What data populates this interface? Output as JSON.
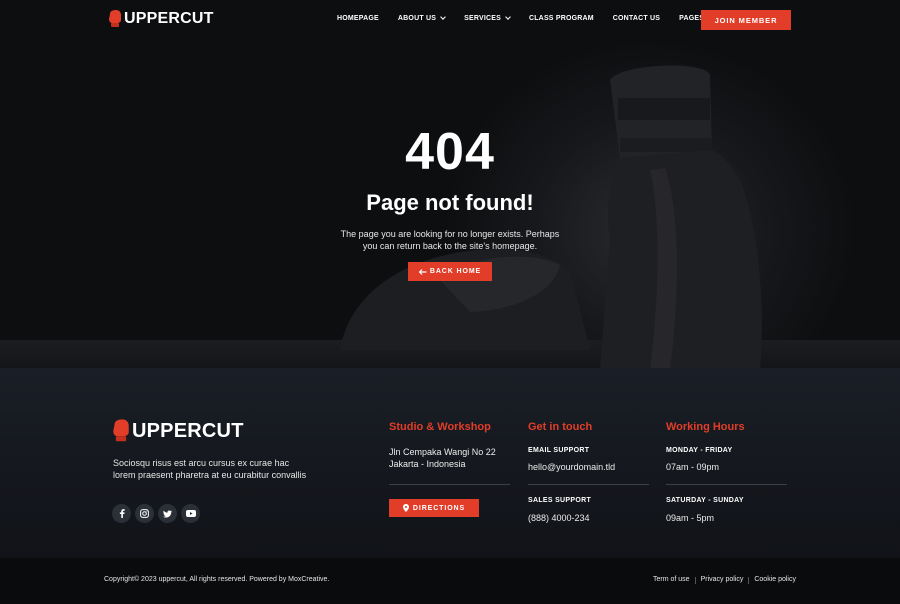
{
  "brand": {
    "name": "UPPERCUT",
    "accent": "#e23d28",
    "logo_icon": "boxing-glove-icon"
  },
  "nav": {
    "items": [
      {
        "label": "HOMEPAGE",
        "has_dropdown": false
      },
      {
        "label": "ABOUT US",
        "has_dropdown": true
      },
      {
        "label": "SERVICES",
        "has_dropdown": true
      },
      {
        "label": "CLASS PROGRAM",
        "has_dropdown": false
      },
      {
        "label": "CONTACT US",
        "has_dropdown": false
      },
      {
        "label": "PAGES",
        "has_dropdown": true
      }
    ],
    "cta": "JOIN MEMBER"
  },
  "error": {
    "code": "404",
    "title": "Page not found!",
    "message_line1": "The page you are looking for no longer exists. Perhaps",
    "message_line2": "you can return back to the site's homepage.",
    "back_button": "BACK HOME"
  },
  "footer": {
    "description": "Sociosqu risus est arcu cursus ex curae hac lorem praesent pharetra at eu curabitur convallis",
    "socials": [
      "facebook-icon",
      "instagram-icon",
      "twitter-icon",
      "youtube-icon"
    ],
    "studio": {
      "heading": "Studio & Workshop",
      "address_line1": "Jln Cempaka Wangi No 22",
      "address_line2": "Jakarta - Indonesia",
      "directions_button": "DIRECTIONS"
    },
    "contact": {
      "heading": "Get in touch",
      "email_label": "EMAIL SUPPORT",
      "email": "hello@yourdomain.tld",
      "sales_label": "SALES SUPPORT",
      "phone": "(888) 4000-234"
    },
    "hours": {
      "heading": "Working Hours",
      "weekday_label": "MONDAY - FRIDAY",
      "weekday_hours": "07am - 09pm",
      "weekend_label": "SATURDAY - SUNDAY",
      "weekend_hours": "09am - 5pm"
    }
  },
  "bottom_bar": {
    "copyright": "Copyright© 2023 uppercut, All rights reserved. Powered by MoxCreative.",
    "links": [
      "Term of use",
      "Privacy policy",
      "Cookie policy"
    ]
  }
}
